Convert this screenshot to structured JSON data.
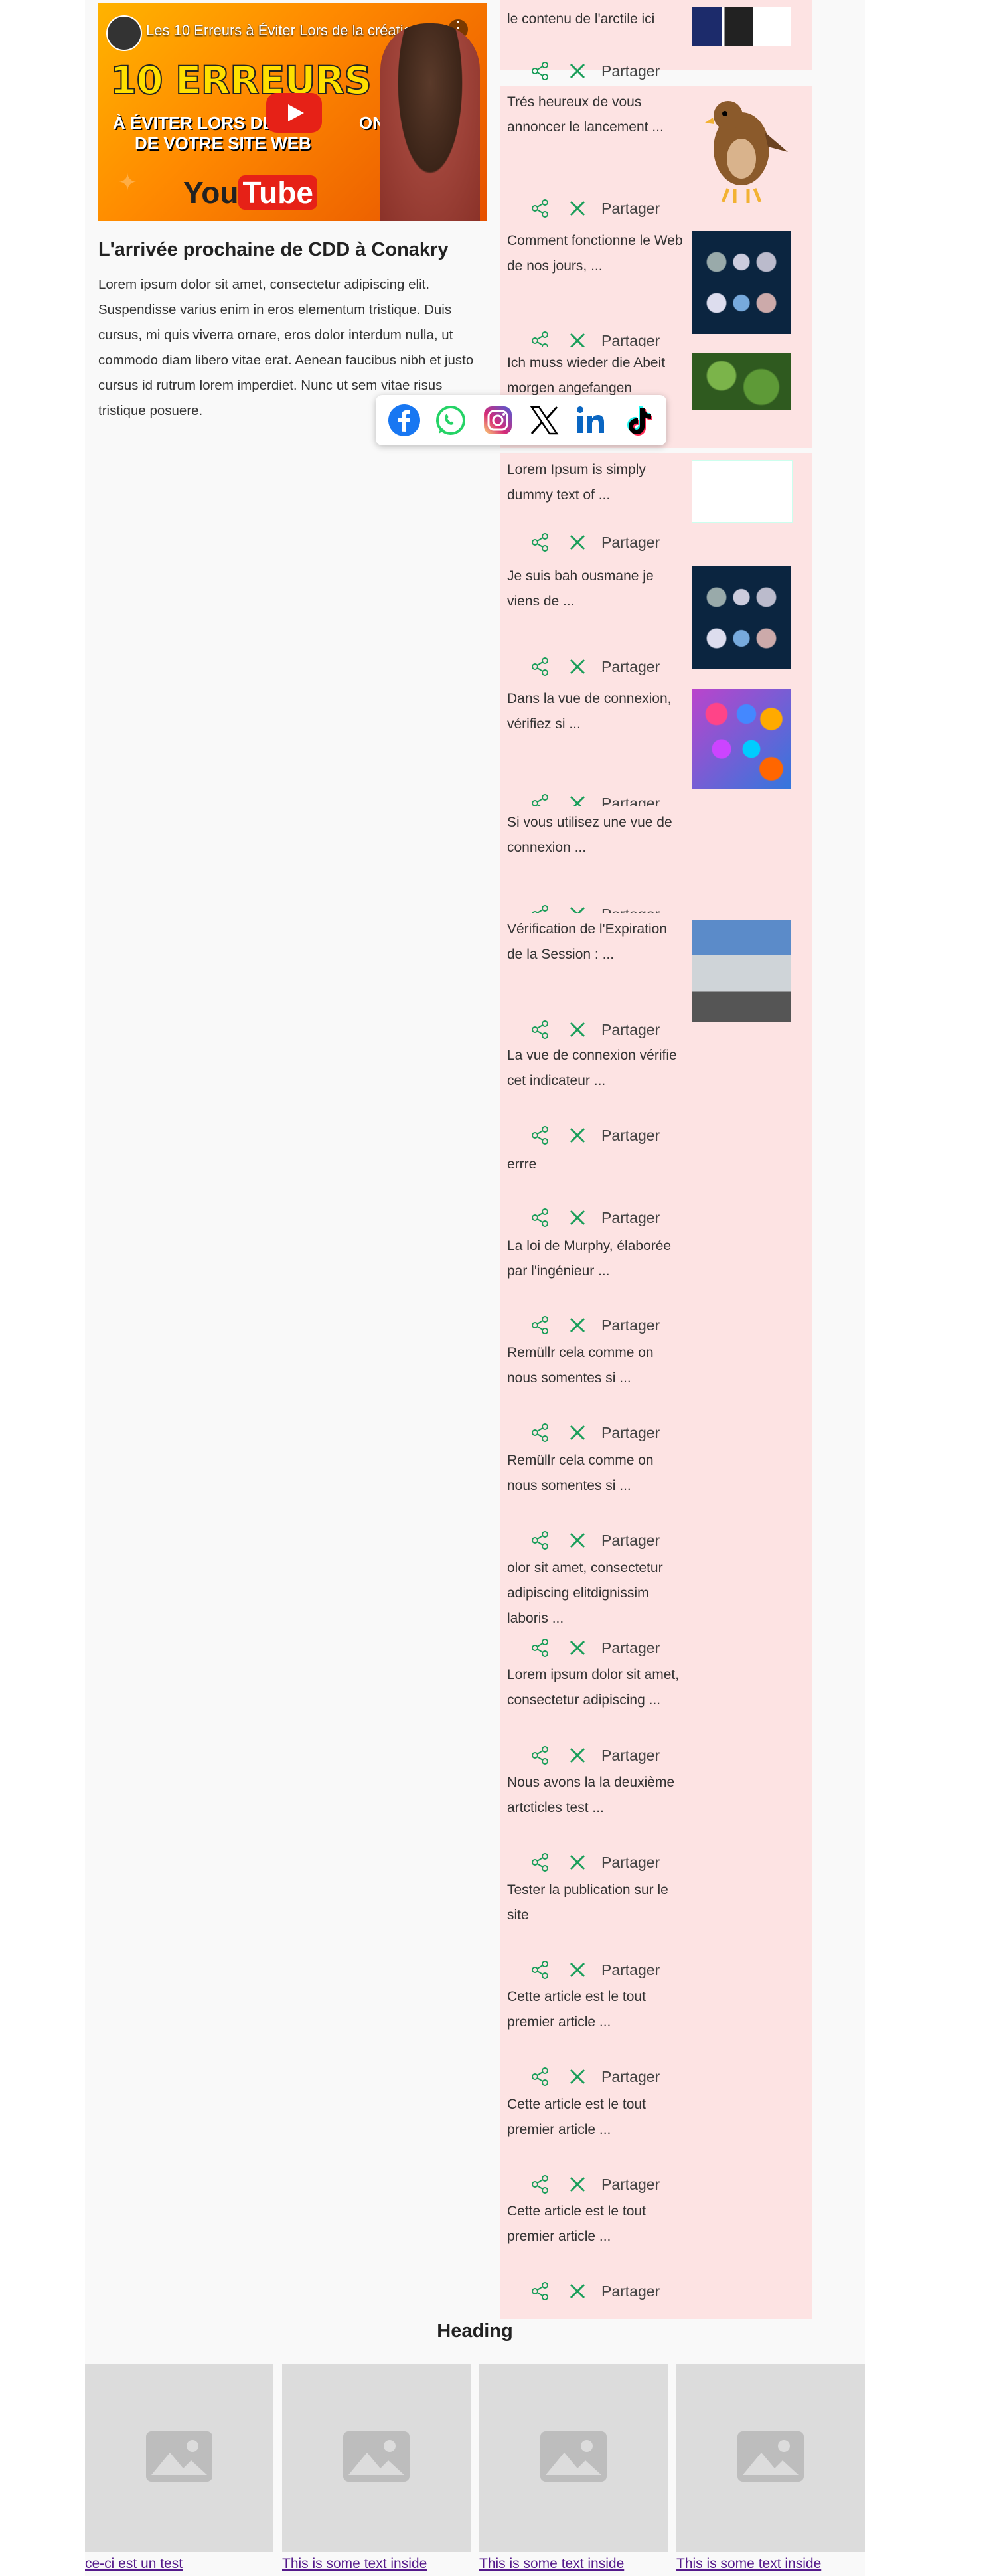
{
  "video": {
    "title": "Les 10 Erreurs à Éviter Lors de la création ...",
    "line1": "10 ERREURS",
    "line2": "À ÉVITER LORS DE LA ",
    "line2b": "ON",
    "line3": "DE VOTRE SITE WEB",
    "brand_you": "You",
    "brand_tube": "Tube"
  },
  "article": {
    "title": "L'arrivée prochaine de CDD à Conakry",
    "body": "Lorem ipsum dolor sit amet, consectetur adipiscing elit. Suspendisse varius enim in eros elementum tristique. Duis cursus, mi quis viverra ornare, eros dolor interdum nulla, ut commodo diam libero vitae erat. Aenean faucibus nibh et justo cursus id rutrum lorem imperdiet. Nunc ut sem vitae risus tristique posuere."
  },
  "share_popup": {
    "facebook_color": "#1877f2",
    "whatsapp_color": "#25d366",
    "linkedin_color": "#0a66c2"
  },
  "share_label": "Partager",
  "cards": [
    {
      "text": "le contenu de l'arctile ici",
      "thumb": "dark"
    },
    {
      "text": "Trés heureux de vous annoncer le lancement ...",
      "thumb": "eagle"
    },
    {
      "text": "Comment fonctionne le Web de nos jours, ...",
      "thumb": "icons"
    },
    {
      "text": "Ich muss wieder die Abeit morgen angefangen",
      "thumb": "green"
    },
    {
      "text": "Lorem Ipsum is simply dummy text of ...",
      "thumb": "screen"
    },
    {
      "text": "Je suis bah ousmane je viens de ...",
      "thumb": "icons"
    },
    {
      "text": "Dans la vue de connexion, vérifiez si ...",
      "thumb": "apps"
    },
    {
      "text": "Si vous utilisez une vue de connexion ...",
      "thumb": ""
    },
    {
      "text": "Vérification de l'Expiration de la Session : ...",
      "thumb": "murphy"
    },
    {
      "text": "La vue de connexion vérifie cet indicateur ...",
      "thumb": ""
    },
    {
      "text": "errre",
      "thumb": ""
    },
    {
      "text": "La loi de Murphy, élaborée par l'ingénieur ...",
      "thumb": ""
    },
    {
      "text": "Remüllr cela comme on nous somentes si ...",
      "thumb": ""
    },
    {
      "text": "Remüllr cela comme on nous somentes si ...",
      "thumb": ""
    },
    {
      "text": "olor sit amet, consectetur adipiscing elitdignissim laboris ...",
      "thumb": ""
    },
    {
      "text": "Lorem ipsum dolor sit amet, consectetur adipiscing ...",
      "thumb": ""
    },
    {
      "text": "Nous avons la la deuxième artcticles test ...",
      "thumb": ""
    },
    {
      "text": "Tester la publication sur le site",
      "thumb": ""
    },
    {
      "text": "Cette article est le tout premier article ...",
      "thumb": ""
    },
    {
      "text": "Cette article est le tout premier article ...",
      "thumb": ""
    },
    {
      "text": "Cette article est le tout premier article ...",
      "thumb": ""
    }
  ],
  "gallery": {
    "heading": "Heading",
    "links": [
      "ce-ci est un test",
      "This is some text inside",
      "This is some text inside",
      "This is some text inside"
    ]
  }
}
